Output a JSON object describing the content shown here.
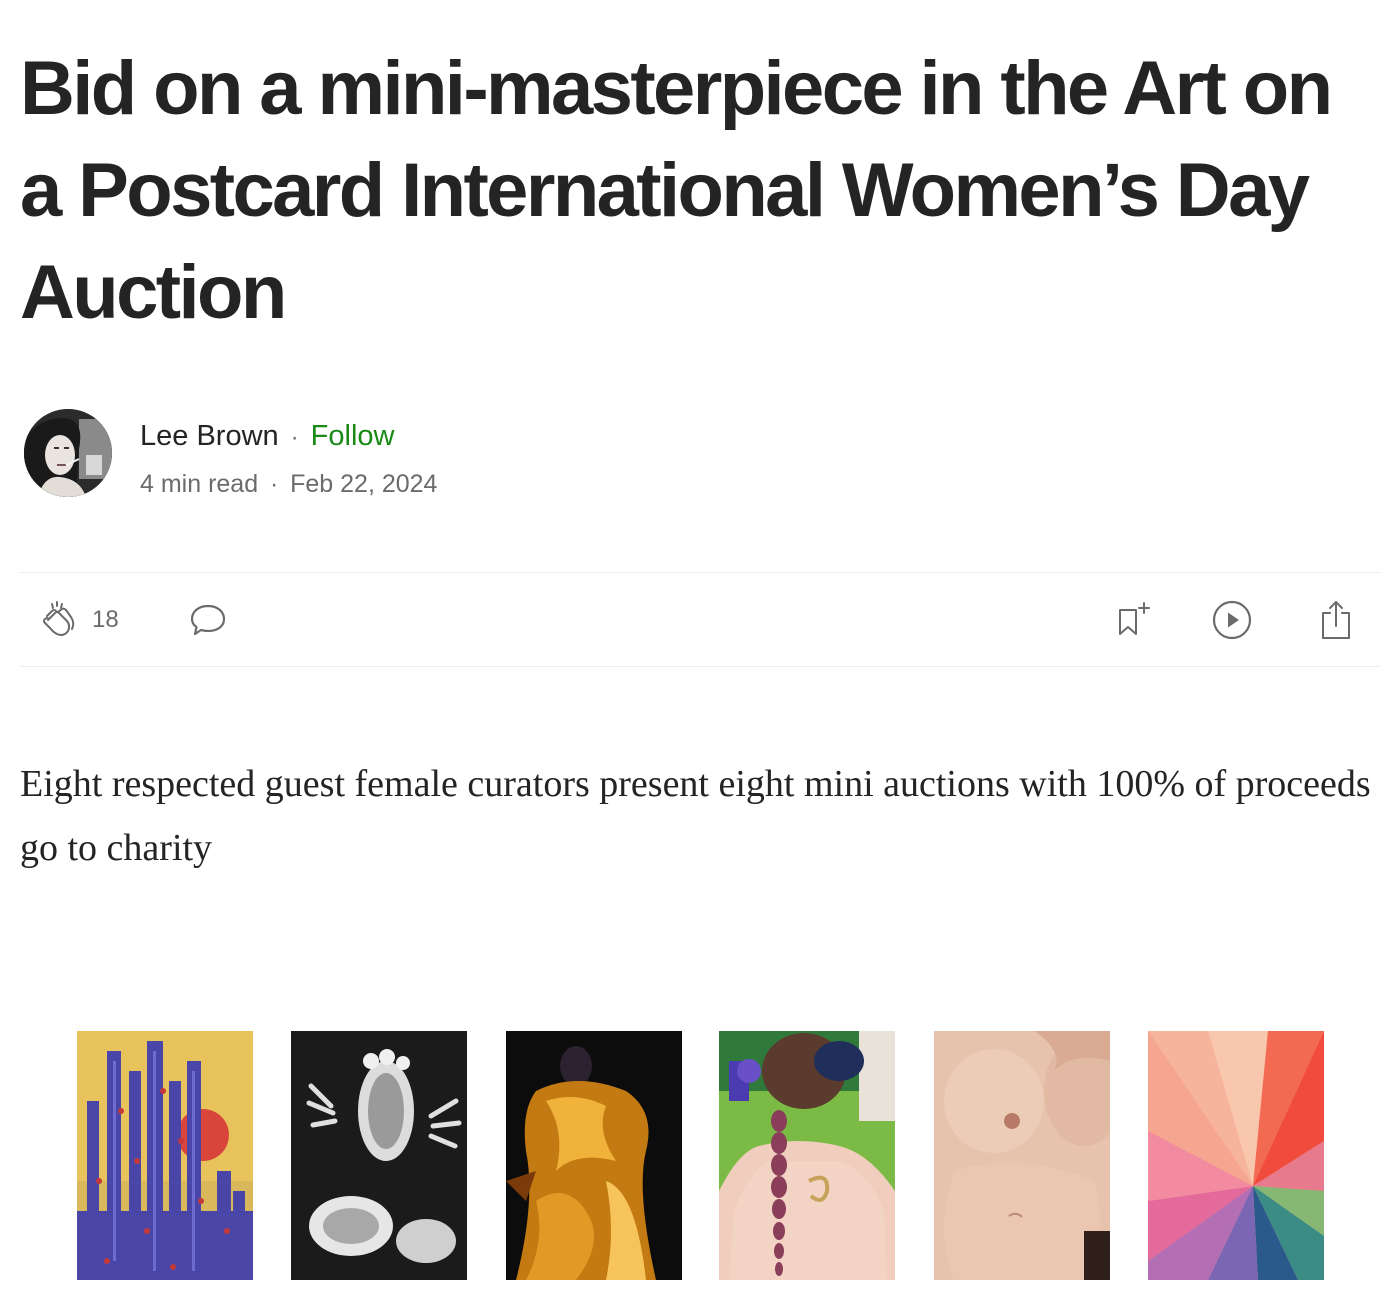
{
  "article": {
    "title": "Bid on a mini-masterpiece in the Art on a Postcard International Women’s Day Auction",
    "subtitle": "Eight respected guest female curators present eight mini auctions with 100% of proceeds go to charity"
  },
  "author": {
    "name": "Lee Brown",
    "follow_label": "Follow",
    "separator": "·",
    "read_time": "4 min read",
    "date": "Feb 22, 2024"
  },
  "actions": {
    "clap_count": "18"
  },
  "colors": {
    "text": "#242424",
    "muted": "#6b6b6b",
    "follow": "#1a8917",
    "divider": "#ececec"
  },
  "icons": [
    "clap-icon",
    "comment-icon",
    "bookmark-add-icon",
    "play-icon",
    "share-icon"
  ]
}
